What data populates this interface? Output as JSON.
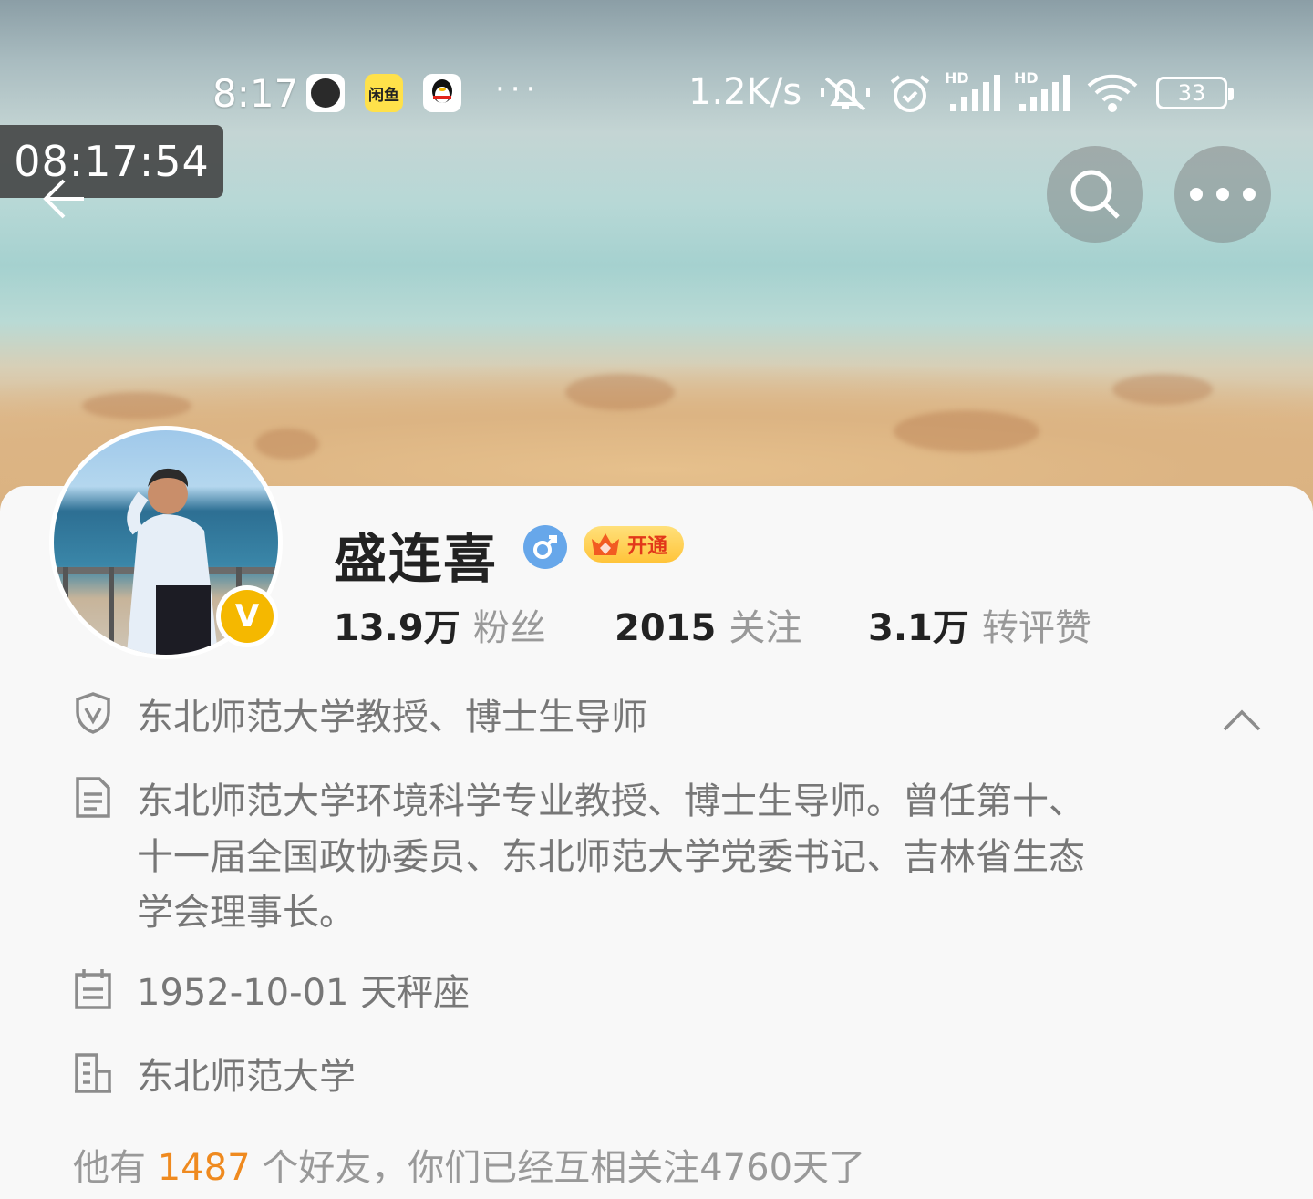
{
  "status_bar": {
    "time": "8:17",
    "app_icon_2_label": "闲鱼",
    "overflow": "···",
    "net_speed": "1.2K/s",
    "hd_1": "HD",
    "hd_2": "HD",
    "battery": "33"
  },
  "screenshot_clock": "08:17:54",
  "profile": {
    "name": "盛连喜",
    "gender": "♂",
    "vip_label": "开通",
    "verify_mark": "V",
    "stats": [
      {
        "value": "13.9万",
        "label": "粉丝"
      },
      {
        "value": "2015",
        "label": "关注"
      },
      {
        "value": "3.1万",
        "label": "转评赞"
      }
    ],
    "verification": "东北师范大学教授、博士生导师",
    "bio_lines": [
      "东北师范大学环境科学专业教授、博士生导师。曾任第十、",
      "十一届全国政协委员、东北师范大学党委书记、吉林省生态",
      "学会理事长。"
    ],
    "birthday": "1952-10-01 天秤座",
    "school": "东北师范大学",
    "friends": {
      "prefix": "他有",
      "count": "1487",
      "suffix": "个好友，你们已经互相关注4760天了"
    }
  },
  "colors": {
    "accent_orange": "#ef8a1f",
    "verify_gold": "#f5b800",
    "gender_blue": "#67a7ea"
  }
}
